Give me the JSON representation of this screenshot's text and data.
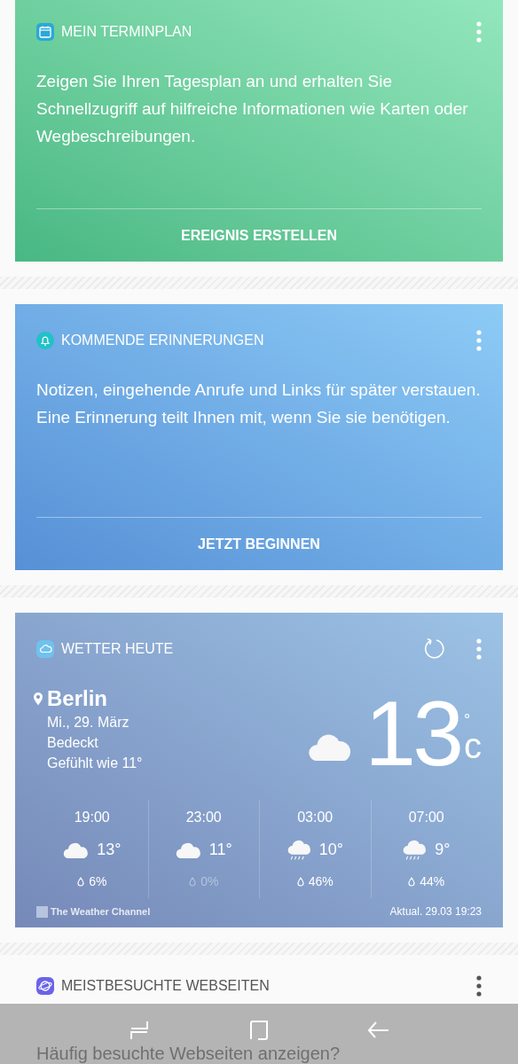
{
  "cards": [
    {
      "kind": "info",
      "title": "MEIN TERMINPLAN",
      "text": "Zeigen Sie Ihren Tagesplan an und erhalten Sie Schnellzugriff auf hilfreiche Informationen wie Karten oder Wegbeschreibungen.",
      "action": "EREIGNIS ERSTELLEN"
    },
    {
      "kind": "info",
      "title": "KOMMENDE ERINNERUNGEN",
      "text": "Notizen, eingehende Anrufe und Links für später verstauen. Eine Erinnerung teilt Ihnen mit, wenn Sie sie benötigen.",
      "action": "JETZT BEGINNEN"
    }
  ],
  "weather": {
    "title": "WETTER HEUTE",
    "city": "Berlin",
    "date": "Mi., 29. März",
    "condition": "Bedeckt",
    "feels_like": "Gefühlt wie 11°",
    "temperature": "13",
    "unit_degree": "°",
    "unit": "c",
    "hourly": [
      {
        "time": "19:00",
        "kind": "cloud",
        "temp": "13°",
        "precip": "6%",
        "dimmed": false
      },
      {
        "time": "23:00",
        "kind": "cloud",
        "temp": "11°",
        "precip": "0%",
        "dimmed": true
      },
      {
        "time": "03:00",
        "kind": "rain",
        "temp": "10°",
        "precip": "46%",
        "dimmed": false
      },
      {
        "time": "07:00",
        "kind": "rain",
        "temp": "9°",
        "precip": "44%",
        "dimmed": false
      }
    ],
    "provider": "The Weather Channel",
    "updated": "Aktual. 29.03 19:23"
  },
  "sites_card": {
    "title": "MEISTBESUCHTE WEBSEITEN",
    "question": "Häufig besuchte Webseiten anzeigen?"
  }
}
